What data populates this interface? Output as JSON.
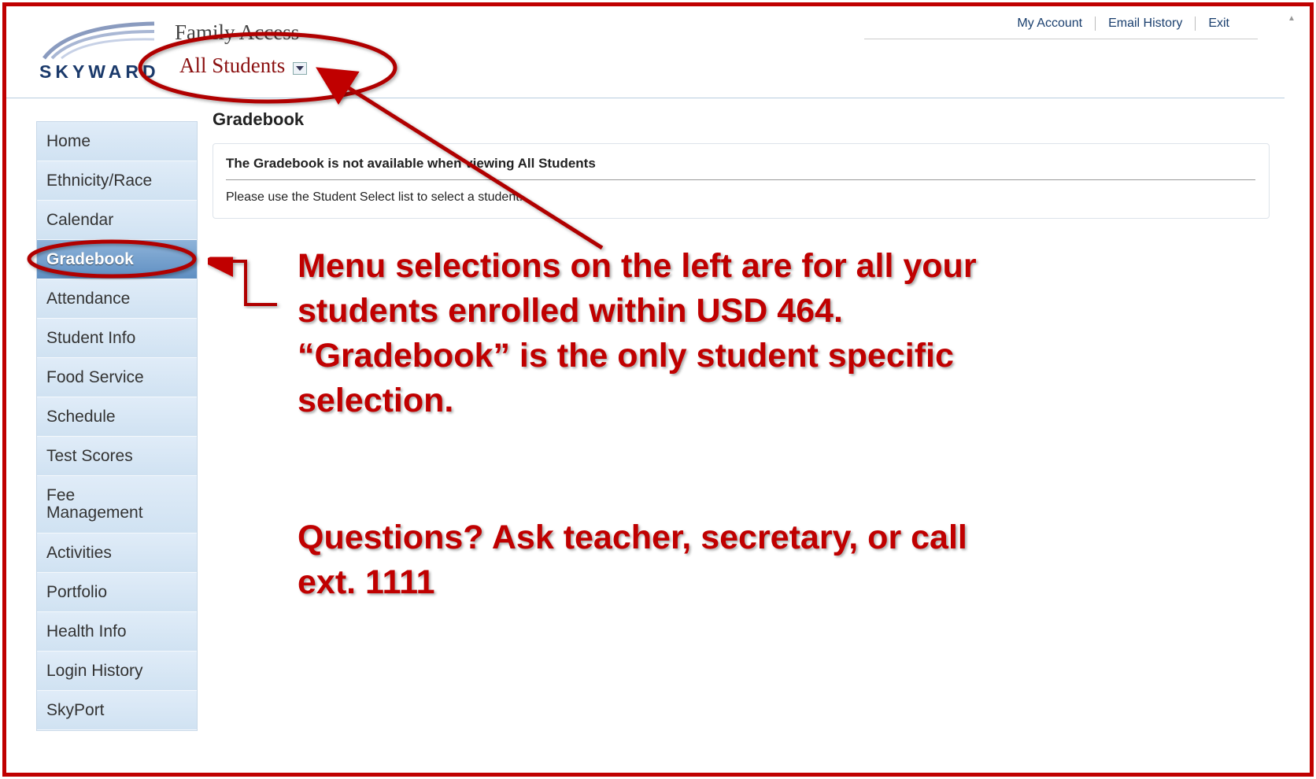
{
  "header": {
    "logo_text": "SKYWARD",
    "app_title": "Family Access",
    "student_select_value": "All Students"
  },
  "toplinks": {
    "my_account": "My Account",
    "email_history": "Email History",
    "exit": "Exit"
  },
  "sidebar": {
    "items": [
      {
        "label": "Home"
      },
      {
        "label": "Ethnicity/Race"
      },
      {
        "label": "Calendar"
      },
      {
        "label": "Gradebook",
        "active": true
      },
      {
        "label": "Attendance"
      },
      {
        "label": "Student Info"
      },
      {
        "label": "Food Service"
      },
      {
        "label": "Schedule"
      },
      {
        "label": "Test Scores"
      },
      {
        "label": "Fee Management"
      },
      {
        "label": "Activities"
      },
      {
        "label": "Portfolio"
      },
      {
        "label": "Health Info"
      },
      {
        "label": "Login History"
      },
      {
        "label": "SkyPort"
      }
    ]
  },
  "main": {
    "page_title": "Gradebook",
    "notice_title": "The Gradebook is not available when viewing All Students",
    "notice_text": "Please use the Student Select list to select a student."
  },
  "annotation": {
    "line1": "Menu selections on the left are for all your students enrolled within USD 464. “Gradebook” is the only student specific selection.",
    "line2": "Questions? Ask teacher, secretary, or call ext. 1111"
  },
  "colors": {
    "annotation_red": "#c00000",
    "nav_bg": "#d6e6f5",
    "nav_active": "#6d99c8",
    "link_blue": "#1a3f6e"
  }
}
